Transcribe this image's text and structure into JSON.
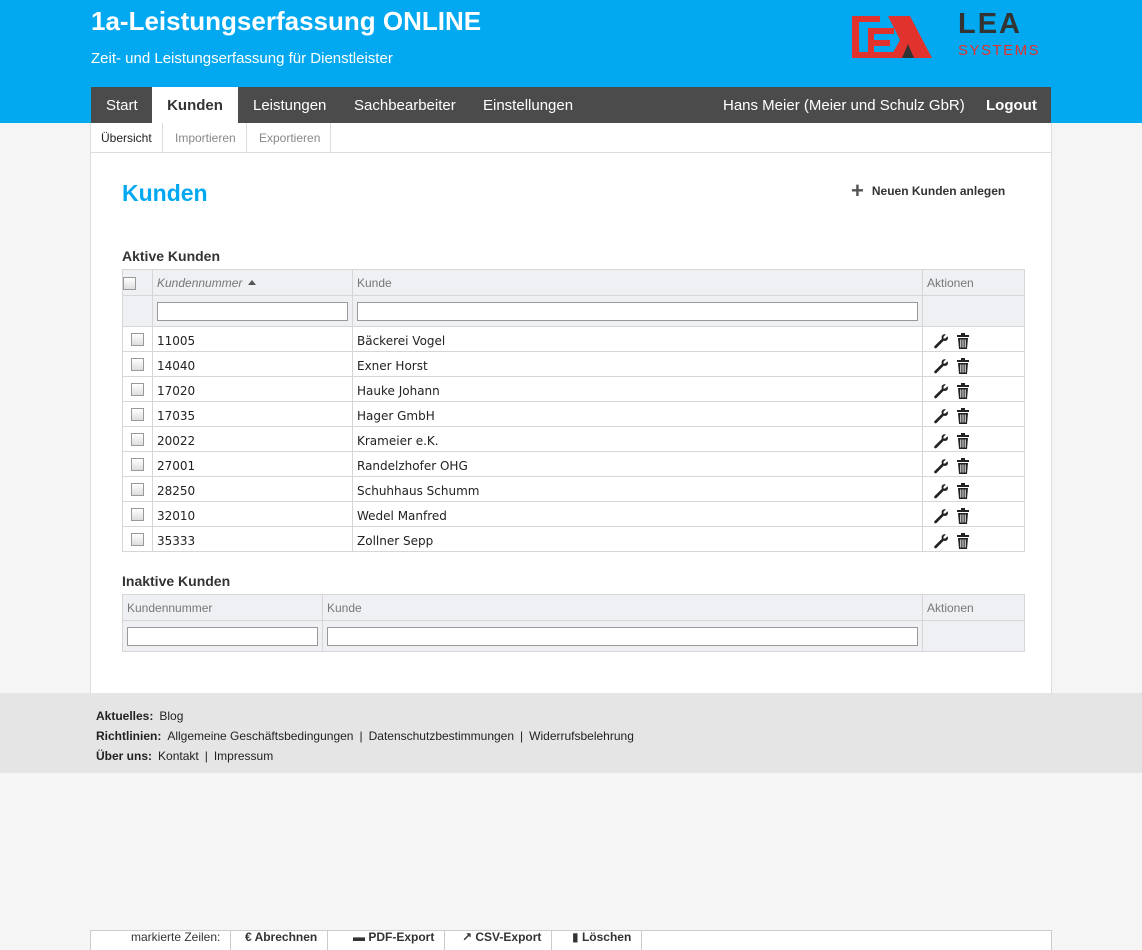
{
  "app": {
    "title": "1a-Leistungserfassung ONLINE",
    "subtitle": "Zeit- und Leistungserfassung für Dienstleister",
    "logo_text_1": "LEA",
    "logo_text_2": "SYSTEMS"
  },
  "nav": {
    "items": [
      {
        "label": "Start"
      },
      {
        "label": "Kunden",
        "active": true
      },
      {
        "label": "Leistungen"
      },
      {
        "label": "Sachbearbeiter"
      },
      {
        "label": "Einstellungen"
      }
    ],
    "user": "Hans Meier (Meier und Schulz GbR)",
    "logout": "Logout"
  },
  "subnav": {
    "items": [
      {
        "label": "Übersicht",
        "active": true
      },
      {
        "label": "Importieren"
      },
      {
        "label": "Exportieren"
      }
    ]
  },
  "page": {
    "title": "Kunden",
    "new_button": "Neuen Kunden anlegen"
  },
  "active_section": {
    "title": "Aktive Kunden",
    "columns": [
      "Kundennummer",
      "Kunde",
      "Aktionen"
    ],
    "rows": [
      {
        "number": "11005",
        "name": "Bäckerei Vogel"
      },
      {
        "number": "14040",
        "name": "Exner Horst"
      },
      {
        "number": "17020",
        "name": "Hauke Johann"
      },
      {
        "number": "17035",
        "name": "Hager GmbH"
      },
      {
        "number": "20022",
        "name": "Krameier e.K."
      },
      {
        "number": "27001",
        "name": "Randelzhofer OHG"
      },
      {
        "number": "28250",
        "name": "Schuhhaus Schumm"
      },
      {
        "number": "32010",
        "name": "Wedel Manfred"
      },
      {
        "number": "35333",
        "name": "Zollner Sepp"
      }
    ]
  },
  "inactive_section": {
    "title": "Inaktive Kunden",
    "columns": [
      "Kundennummer",
      "Kunde",
      "Aktionen"
    ]
  },
  "footer": {
    "news_label": "Aktuelles:",
    "news_link": "Blog",
    "policies_label": "Richtlinien:",
    "policies": [
      "Allgemeine Geschäftsbedingungen",
      "Datenschutzbestimmungen",
      "Widerrufsbelehrung"
    ],
    "about_label": "Über uns:",
    "about": [
      "Kontakt",
      "Impressum"
    ]
  },
  "bottom_bar": {
    "label": "markierte Zeilen:",
    "actions": [
      "Abrechnen",
      "PDF-Export",
      "CSV-Export",
      "Löschen"
    ]
  },
  "colors": {
    "brand_blue": "#03a9f0",
    "nav_dark": "#4a4b4a",
    "logo_red": "#e2322d"
  }
}
